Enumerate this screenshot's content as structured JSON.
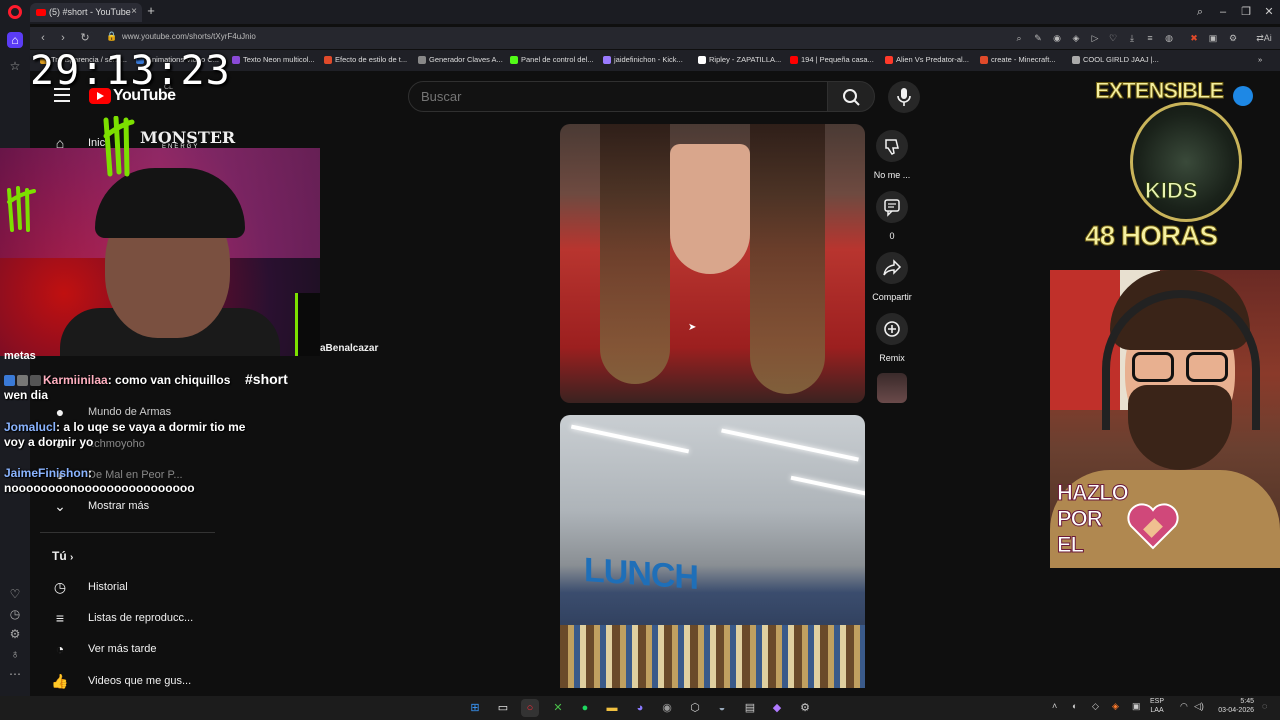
{
  "browser": {
    "tab_title": "(5) #short - YouTube",
    "url": "www.youtube.com/shorts/tXyrF4uJnio",
    "bookmarks": [
      {
        "label": "Transparencia / semi...",
        "color": "#e0a020"
      },
      {
        "label": "Animations Video C...",
        "color": "#3a7ad8"
      },
      {
        "label": "Texto Neon multicol...",
        "color": "#8a4ad8"
      },
      {
        "label": "Efecto de estilo de t...",
        "color": "#e04a2a"
      },
      {
        "label": "Generador Claves A...",
        "color": "#888888"
      },
      {
        "label": "Panel de control del...",
        "color": "#53fc18"
      },
      {
        "label": "jaidefinichon - Kick...",
        "color": "#9a7aff"
      },
      {
        "label": "Ripley - ZAPATILLA...",
        "color": "#ffffff"
      },
      {
        "label": "194 | Pequeña casa...",
        "color": "#ff0000"
      },
      {
        "label": "Alien Vs Predator-al...",
        "color": "#ff3a2a"
      },
      {
        "label": "create - Minecraft...",
        "color": "#e04a2a"
      },
      {
        "label": "COOL GIRLD JAAJ |...",
        "color": "#aaaaaa"
      }
    ]
  },
  "youtube": {
    "logo_text": "YouTube",
    "country": "CL",
    "search_placeholder": "Buscar",
    "nav": {
      "home_label": "Inic",
      "item_weapons": "Mundo de Armas",
      "item_user": "uchmoyoho",
      "item_worse": "De Mal en Peor P...",
      "show_more": "Mostrar más",
      "you": "Tú",
      "history": "Historial",
      "playlists": "Listas de reproducc...",
      "watch_later": "Ver más tarde",
      "liked": "Videos que me gus..."
    },
    "short": {
      "dislike_label": "No me ...",
      "comments_count": "0",
      "share_label": "Compartir",
      "remix_label": "Remix",
      "video2_sign": "LUNCH"
    }
  },
  "overlay": {
    "timer": "29:13:23",
    "monster_brand": "MONSTER",
    "monster_sub": "ENERGY",
    "channel_fragment": "aBenalcazar",
    "short_tag": "#short",
    "chat_header": "metas",
    "chat": [
      {
        "user": "Karmiinilaa",
        "message": ": como van chiquillos wen dia"
      },
      {
        "user": "Jomalucl",
        "message": ": a lo uqe se vaya a dormir tio me voy a dormir yo"
      },
      {
        "user": "JaimeFinishon",
        "message": ": noooooooonoooooooooooooooo"
      }
    ],
    "extensible": "EXTENSIBLE",
    "kids": "KIDS",
    "horas": "48 HORAS",
    "hazlo": [
      "HAZLO",
      "POR",
      "EL"
    ]
  },
  "taskbar": {
    "lang_top": "ESP",
    "lang_bottom": "LAA",
    "time": "5:45",
    "date": "03-04-2026"
  }
}
